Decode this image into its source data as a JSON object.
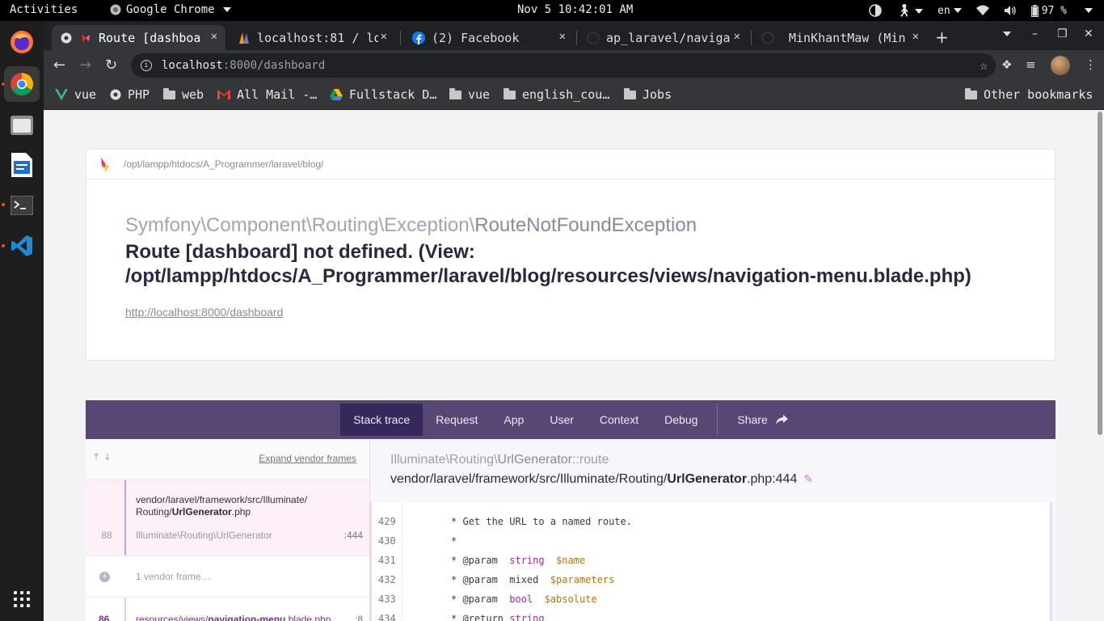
{
  "system": {
    "activities": "Activities",
    "app_name": "Google Chrome",
    "clock": "Nov 5  10:42:01 AM",
    "lang": "en",
    "battery": "97 %"
  },
  "browser": {
    "tabs": [
      {
        "title": "Route [dashboard",
        "favicon": "laravel-ignition-icon"
      },
      {
        "title": "localhost:81 / lo",
        "favicon": "phpmyadmin-icon"
      },
      {
        "title": "(2) Facebook",
        "favicon": "facebook-icon"
      },
      {
        "title": "ap_laravel/naviga",
        "favicon": "github-icon"
      },
      {
        "title": "MinKhantMaw (Min",
        "favicon": "github-icon"
      }
    ],
    "url_host": "localhost",
    "url_path": ":8000/dashboard",
    "bookmarks": [
      {
        "label": "vue",
        "icon": "vue-icon"
      },
      {
        "label": "PHP",
        "icon": "globe-icon"
      },
      {
        "label": "web",
        "icon": "folder-icon"
      },
      {
        "label": "All Mail -…",
        "icon": "gmail-icon"
      },
      {
        "label": "Fullstack D…",
        "icon": "drive-icon"
      },
      {
        "label": "vue",
        "icon": "folder-icon"
      },
      {
        "label": "english_cou…",
        "icon": "folder-icon"
      },
      {
        "label": "Jobs",
        "icon": "folder-icon"
      }
    ],
    "other_bookmarks": "Other bookmarks"
  },
  "error": {
    "app_path": "/opt/lampp/htdocs/A_Programmer/laravel/blog/",
    "exception_namespace": "Symfony\\Component\\Routing\\Exception\\",
    "exception_class": "RouteNotFoundException",
    "message": "Route [dashboard] not defined. (View: /opt/lampp/htdocs/A_Programmer/laravel/blog/resources/views/navigation-menu.blade.php)",
    "url": "http://localhost:8000/dashboard"
  },
  "tabs": {
    "items": [
      "Stack trace",
      "Request",
      "App",
      "User",
      "Context",
      "Debug"
    ],
    "share": "Share"
  },
  "stack": {
    "expand_vendor": "Expand vendor frames",
    "frame1": {
      "file_prefix": "vendor/laravel/framework/src/Illuminate/",
      "file_dir": "Routing/",
      "file_name": "UrlGenerator",
      "file_ext": ".php",
      "number": "88",
      "class": "Illuminate\\Routing\\UrlGenerator",
      "line": ":444"
    },
    "vendor_frames": "1 vendor frame…",
    "frame2": {
      "number": "86",
      "file_dir": "resources/views/",
      "file_name": "navigation-menu",
      "file_ext": ".blade.php",
      "line": ":8"
    }
  },
  "detail": {
    "method_ns": "Illuminate\\Routing\\",
    "method_class": "UrlGenerator",
    "method_name": "::route",
    "file_prefix": "vendor/laravel/framework/src/Illuminate/Routing/",
    "file_name": "UrlGenerator",
    "file_suffix": ".php:444",
    "code": [
      {
        "n": "429",
        "parts": [
          {
            "t": "* Get the URL to a named route.",
            "k": ""
          }
        ]
      },
      {
        "n": "430",
        "parts": [
          {
            "t": "*",
            "k": ""
          }
        ]
      },
      {
        "n": "431",
        "parts": [
          {
            "t": "* @param  ",
            "k": ""
          },
          {
            "t": "string",
            "k": "kw"
          },
          {
            "t": "  ",
            "k": ""
          },
          {
            "t": "$name",
            "k": "var"
          }
        ]
      },
      {
        "n": "432",
        "parts": [
          {
            "t": "* @param  mixed  ",
            "k": ""
          },
          {
            "t": "$parameters",
            "k": "var"
          }
        ]
      },
      {
        "n": "433",
        "parts": [
          {
            "t": "* @param  ",
            "k": ""
          },
          {
            "t": "bool",
            "k": "kw"
          },
          {
            "t": "  ",
            "k": ""
          },
          {
            "t": "$absolute",
            "k": "var"
          }
        ]
      },
      {
        "n": "434",
        "parts": [
          {
            "t": "* @return ",
            "k": ""
          },
          {
            "t": "string",
            "k": "kw"
          }
        ]
      }
    ]
  }
}
